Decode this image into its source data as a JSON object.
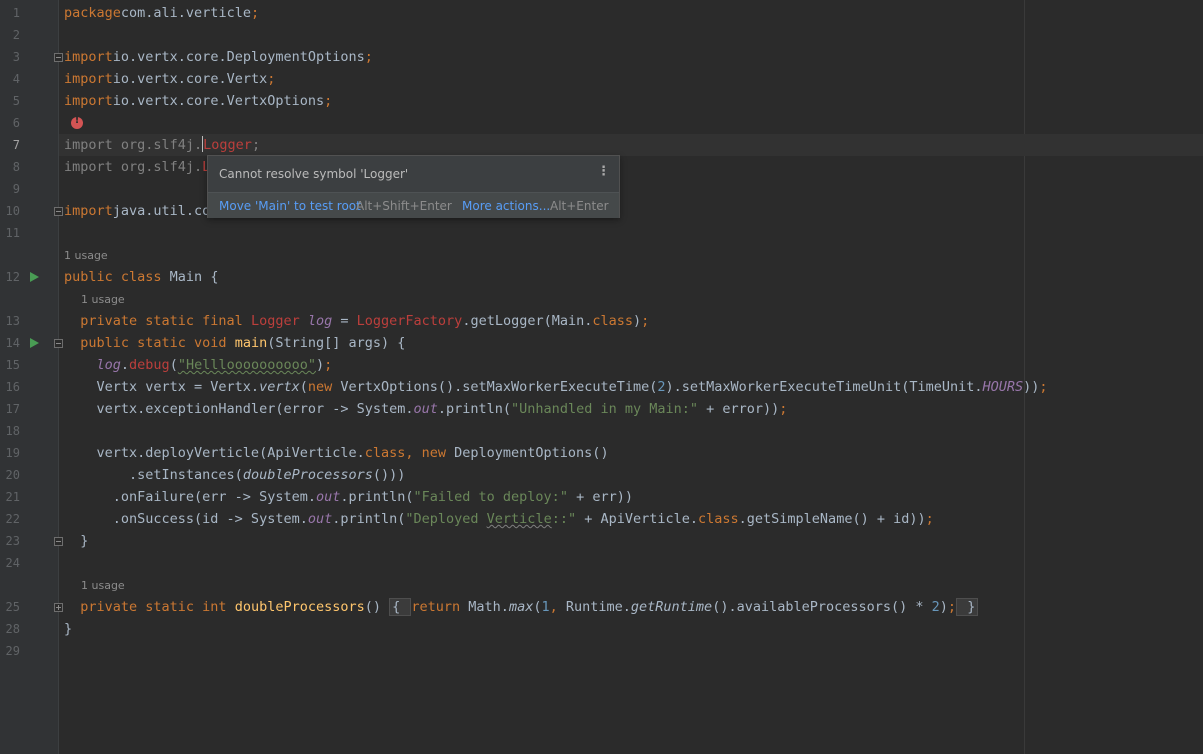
{
  "editor": {
    "lines": [
      {
        "num": "1",
        "tokens": [
          [
            "kw",
            "package"
          ],
          [
            "",
            "com.ali.verticle"
          ],
          [
            "kw",
            ";"
          ]
        ]
      },
      {
        "num": "2",
        "tokens": []
      },
      {
        "num": "3",
        "tokens": [
          [
            "kw",
            "import"
          ],
          [
            "",
            "io.vertx.core.DeploymentOptions"
          ],
          [
            "kw",
            ";"
          ]
        ]
      },
      {
        "num": "4",
        "tokens": [
          [
            "kw",
            "import"
          ],
          [
            "",
            "io.vertx.core.Vertx"
          ],
          [
            "kw",
            ";"
          ]
        ]
      },
      {
        "num": "5",
        "tokens": [
          [
            "kw",
            "import"
          ],
          [
            "",
            "io.vertx.core.VertxOptions"
          ],
          [
            "kw",
            ";"
          ]
        ]
      },
      {
        "num": "6",
        "tokens": []
      },
      {
        "num": "7",
        "tokens": [
          [
            "gray",
            "import org.slf4j."
          ],
          [
            "caret",
            ""
          ],
          [
            "err",
            "Logger"
          ],
          [
            "gray",
            ";"
          ]
        ]
      },
      {
        "num": "8",
        "tokens": [
          [
            "gray",
            "import org.slf4j."
          ],
          [
            "err",
            "LoggerFactory"
          ],
          [
            "gray",
            ";"
          ]
        ]
      },
      {
        "num": "9",
        "tokens": []
      },
      {
        "num": "10",
        "tokens": [
          [
            "kw",
            "import"
          ],
          [
            "",
            "java.util.concurrent.TimeUnit"
          ],
          [
            "kw",
            ";"
          ]
        ]
      },
      {
        "num": "11",
        "tokens": []
      },
      {
        "num": "12",
        "tokens": [
          [
            "kw",
            "public class"
          ],
          [
            "",
            " Main {"
          ]
        ]
      },
      {
        "num": "13",
        "tokens": [
          [
            "kw",
            "  private static final "
          ],
          [
            "err",
            "Logger"
          ],
          [
            "",
            " "
          ],
          [
            "itfld",
            "log"
          ],
          [
            "",
            " = "
          ],
          [
            "err",
            "LoggerFactory"
          ],
          [
            "",
            ".getLogger(Main."
          ],
          [
            "kw",
            "class"
          ],
          [
            "",
            ")"
          ],
          [
            "kw",
            ";"
          ]
        ]
      },
      {
        "num": "14",
        "tokens": [
          [
            "kw",
            "  public static void "
          ],
          [
            "fn",
            "main"
          ],
          [
            "",
            "(String[] args) {"
          ]
        ]
      },
      {
        "num": "15",
        "tokens": [
          [
            "",
            "    "
          ],
          [
            "itfld",
            "log"
          ],
          [
            "",
            "."
          ],
          [
            "err",
            "debug"
          ],
          [
            "",
            "("
          ],
          [
            "strw",
            "\"Hellloooooooooo\""
          ],
          [
            "",
            ")"
          ],
          [
            "kw",
            ";"
          ]
        ]
      },
      {
        "num": "16",
        "tokens": [
          [
            "",
            "    Vertx vertx = Vertx."
          ],
          [
            "itfn",
            "vertx"
          ],
          [
            "",
            "("
          ],
          [
            "kw",
            "new "
          ],
          [
            "",
            "VertxOptions().setMaxWorkerExecuteTime("
          ],
          [
            "num",
            "2"
          ],
          [
            "",
            ").setMaxWorkerExecuteTimeUnit(TimeUnit."
          ],
          [
            "itfld",
            "HOURS"
          ],
          [
            "",
            "))"
          ],
          [
            "kw",
            ";"
          ]
        ]
      },
      {
        "num": "17",
        "tokens": [
          [
            "",
            "    vertx.exceptionHandler(error -> System."
          ],
          [
            "itfld",
            "out"
          ],
          [
            "",
            ".println("
          ],
          [
            "str",
            "\"Unhandled in my Main:\""
          ],
          [
            "",
            " + error))"
          ],
          [
            "kw",
            ";"
          ]
        ]
      },
      {
        "num": "18",
        "tokens": []
      },
      {
        "num": "19",
        "tokens": [
          [
            "",
            "    vertx.deployVerticle(ApiVerticle."
          ],
          [
            "kw",
            "class, new "
          ],
          [
            "",
            "DeploymentOptions()"
          ]
        ]
      },
      {
        "num": "20",
        "tokens": [
          [
            "",
            "        .setInstances("
          ],
          [
            "itfn",
            "doubleProcessors"
          ],
          [
            "",
            "()))"
          ]
        ]
      },
      {
        "num": "21",
        "tokens": [
          [
            "",
            "      .onFailure(err -> System."
          ],
          [
            "itfld",
            "out"
          ],
          [
            "",
            ".println("
          ],
          [
            "str",
            "\"Failed to deploy:\""
          ],
          [
            "",
            " + err))"
          ]
        ]
      },
      {
        "num": "22",
        "tokens": [
          [
            "",
            "      .onSuccess(id -> System."
          ],
          [
            "itfld",
            "out"
          ],
          [
            "",
            ".println("
          ],
          [
            "str",
            "\"Deployed "
          ],
          [
            "strw2",
            "Verticle"
          ],
          [
            "str",
            "::\""
          ],
          [
            "",
            " + ApiVerticle."
          ],
          [
            "kw",
            "class"
          ],
          [
            "",
            ".getSimpleName() + id))"
          ],
          [
            "kw",
            ";"
          ]
        ]
      },
      {
        "num": "23",
        "tokens": [
          [
            "",
            "  }"
          ]
        ]
      },
      {
        "num": "24",
        "tokens": []
      },
      {
        "num": "25",
        "tokens": [
          [
            "kw",
            "  private static int "
          ],
          [
            "fn",
            "doubleProcessors"
          ],
          [
            "",
            "() "
          ],
          [
            "fold",
            "{ "
          ],
          [
            "kw",
            "return "
          ],
          [
            "",
            "Math."
          ],
          [
            "itfn",
            "max"
          ],
          [
            "",
            "("
          ],
          [
            "num",
            "1"
          ],
          [
            "kw",
            ", "
          ],
          [
            "",
            "Runtime."
          ],
          [
            "itfn",
            "getRuntime"
          ],
          [
            "",
            "().availableProcessors() * "
          ],
          [
            "num",
            "2"
          ],
          [
            "",
            ")"
          ],
          [
            "kw",
            ";"
          ],
          [
            "fold",
            " }"
          ]
        ]
      },
      {
        "num": "28",
        "tokens": [
          [
            "",
            "}"
          ]
        ]
      },
      {
        "num": "29",
        "tokens": []
      }
    ],
    "usage_hints": [
      "1 usage",
      "1 usage",
      "1 usage"
    ]
  },
  "popup": {
    "message": "Cannot resolve symbol 'Logger'",
    "menu_glyph": "⋮",
    "primary_action": "Move 'Main' to test root",
    "primary_shortcut": "Alt+Shift+Enter",
    "more_action": "More actions...",
    "more_shortcut": "Alt+Enter"
  },
  "colors": {
    "background": "#2b2b2b",
    "keyword": "#cc7832",
    "string": "#6a8759",
    "error": "#bc3f3c",
    "link": "#589df6"
  }
}
